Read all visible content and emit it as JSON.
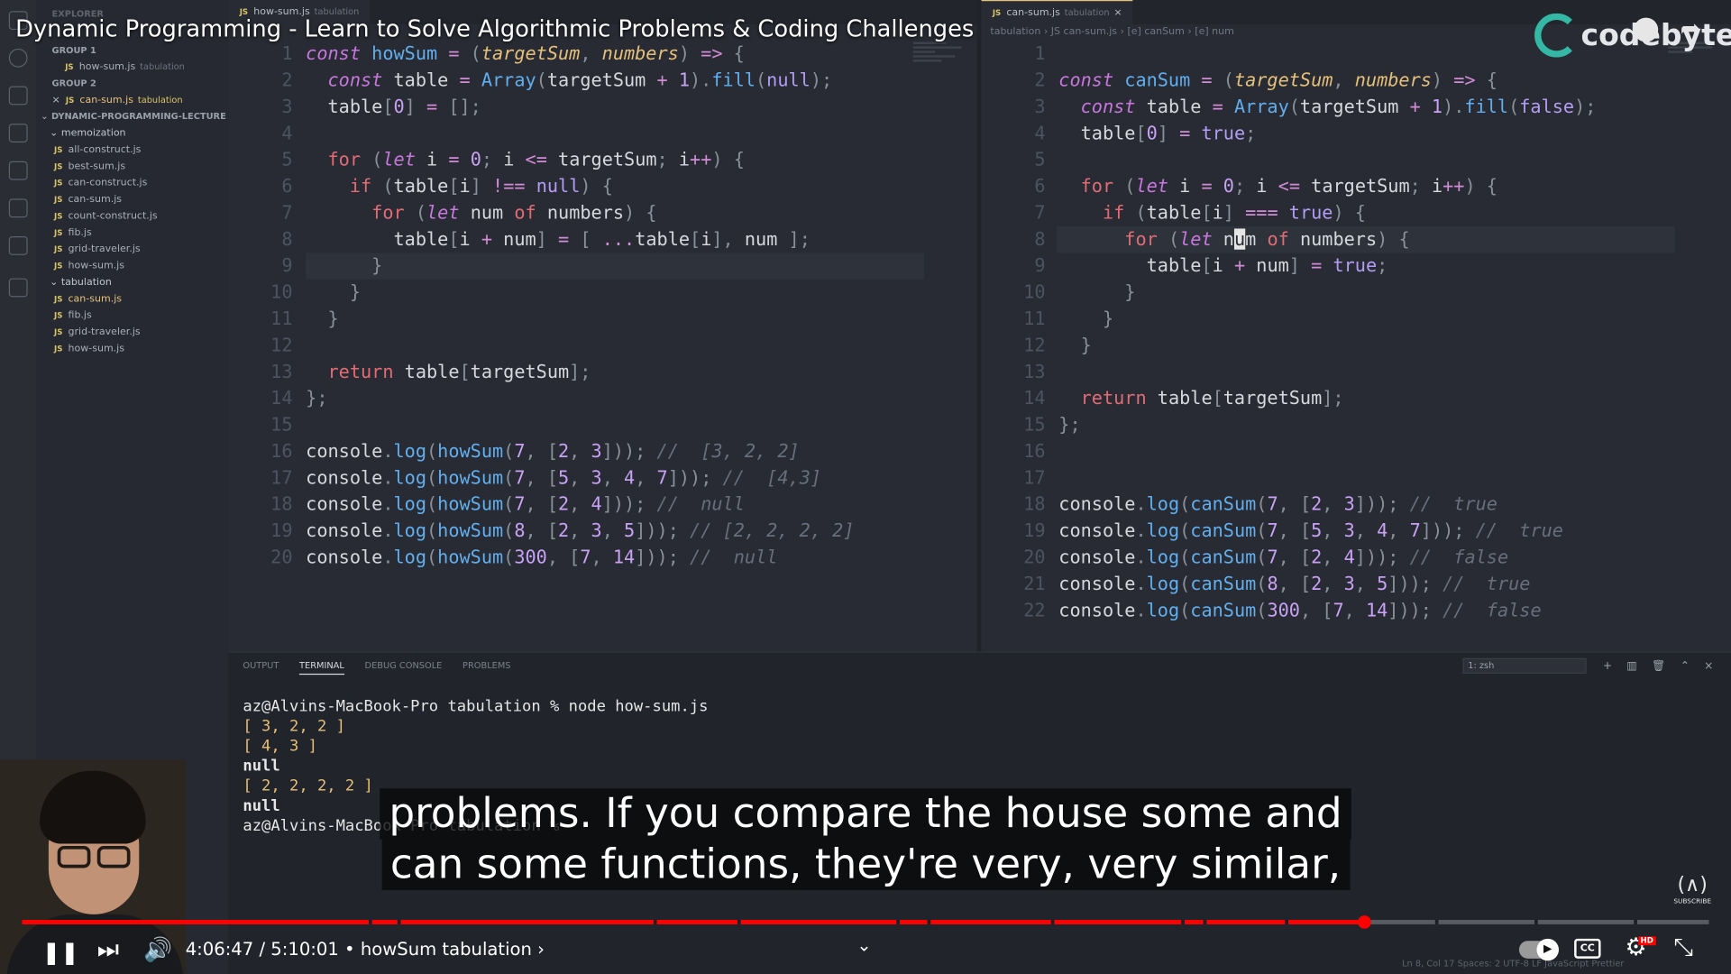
{
  "video": {
    "title": "Dynamic Programming - Learn to Solve Algorithmic Problems & Coding Challenges",
    "channel": "codebyte",
    "subtitle_line1": "problems. If you compare the house some and",
    "subtitle_line2": "can some functions, they're very, very similar,",
    "time_display": "4:06:47 / 5:10:01",
    "chapter_label": "howSum tabulation",
    "progress_fraction": 0.7955,
    "accent_color": "#ff0000"
  },
  "sidebar": {
    "header": "EXPLORER",
    "group1_label": "GROUP 1",
    "group1_file": "how-sum.js",
    "group1_file_tag": "tabulation",
    "group2_label": "GROUP 2",
    "group2_file": "can-sum.js",
    "group2_file_tag": "tabulation",
    "project": "DYNAMIC-PROGRAMMING-LECTURE",
    "folder_memo": "memoization",
    "memo_files": [
      "all-construct.js",
      "best-sum.js",
      "can-construct.js",
      "can-sum.js",
      "count-construct.js",
      "fib.js",
      "grid-traveler.js",
      "how-sum.js"
    ],
    "folder_tab": "tabulation",
    "tab_files": [
      "can-sum.js",
      "fib.js",
      "grid-traveler.js",
      "how-sum.js"
    ]
  },
  "left_editor": {
    "tab": "how-sum.js",
    "tab_tag": "tabulation"
  },
  "right_editor": {
    "tab": "can-sum.js",
    "tab_tag": "tabulation",
    "crumbs": "tabulation  ›  JS can-sum.js  ›  [e] canSum  ›  [e] num"
  },
  "panel": {
    "tabs": [
      "OUTPUT",
      "TERMINAL",
      "DEBUG CONSOLE",
      "PROBLEMS"
    ],
    "shell": "1: zsh",
    "lines": [
      "az@Alvins-MacBook-Pro tabulation % node how-sum.js",
      "[ 3, 2, 2 ]",
      "[ 4, 3 ]",
      "null",
      "[ 2, 2, 2, 2 ]",
      "null",
      "az@Alvins-MacBook-Pro tabulation % "
    ]
  },
  "statusbar": "Ln 8, Col 17   Spaces: 2   UTF-8   LF   JavaScript   Prettier"
}
